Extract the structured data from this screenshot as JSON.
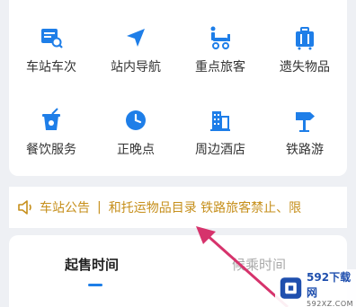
{
  "services": [
    {
      "label": "车站车次",
      "icon": "station-search-icon"
    },
    {
      "label": "站内导航",
      "icon": "navigation-arrow-icon"
    },
    {
      "label": "重点旅客",
      "icon": "wheelchair-icon"
    },
    {
      "label": "遗失物品",
      "icon": "luggage-icon"
    },
    {
      "label": "餐饮服务",
      "icon": "drink-cup-icon"
    },
    {
      "label": "正晚点",
      "icon": "clock-icon"
    },
    {
      "label": "周边酒店",
      "icon": "hotel-building-icon"
    },
    {
      "label": "铁路游",
      "icon": "signpost-icon"
    }
  ],
  "notice": {
    "label": "车站公告",
    "separator": "|",
    "text": "和托运物品目录   铁路旅客禁止、限",
    "icon": "speaker-icon"
  },
  "tabs": [
    {
      "label": "起售时间",
      "active": true
    },
    {
      "label": "候乘时间",
      "active": false
    }
  ],
  "watermark": {
    "title": "592下载网",
    "subtitle": "592XZ.COM"
  },
  "colors": {
    "icon_blue": "#1e7ee8",
    "notice_gold": "#c68f1b",
    "arrow_pink": "#d6336c"
  }
}
